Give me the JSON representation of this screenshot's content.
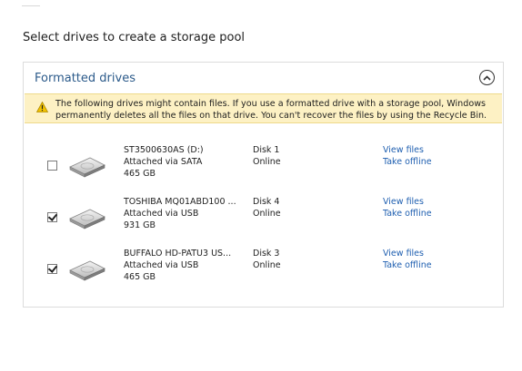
{
  "page": {
    "title": "Select drives to create a storage pool"
  },
  "group": {
    "title": "Formatted drives",
    "warning": "The following drives might contain files. If you use a formatted drive with a storage pool, Windows permanently deletes all the files on that drive. You can't recover the files by using the Recycle Bin."
  },
  "drives": [
    {
      "checked": false,
      "name": "ST3500630AS (D:)",
      "connection": "Attached via SATA",
      "size": "465 GB",
      "disk": "Disk 1",
      "status": "Online",
      "view_label": "View files",
      "offline_label": "Take offline"
    },
    {
      "checked": true,
      "name": "TOSHIBA MQ01ABD100 ...",
      "connection": "Attached via USB",
      "size": "931 GB",
      "disk": "Disk 4",
      "status": "Online",
      "view_label": "View files",
      "offline_label": "Take offline"
    },
    {
      "checked": true,
      "name": "BUFFALO HD-PATU3 US...",
      "connection": "Attached via USB",
      "size": "465 GB",
      "disk": "Disk 3",
      "status": "Online",
      "view_label": "View files",
      "offline_label": "Take offline"
    }
  ],
  "icons": {
    "collapse": "chevron-up-icon",
    "warning": "warning-icon",
    "drive": "hard-drive-icon"
  },
  "colors": {
    "header": "#2b5a8a",
    "link": "#1f5fb0",
    "warning_bg": "#fdf1c4",
    "border": "#dcdcdc"
  }
}
